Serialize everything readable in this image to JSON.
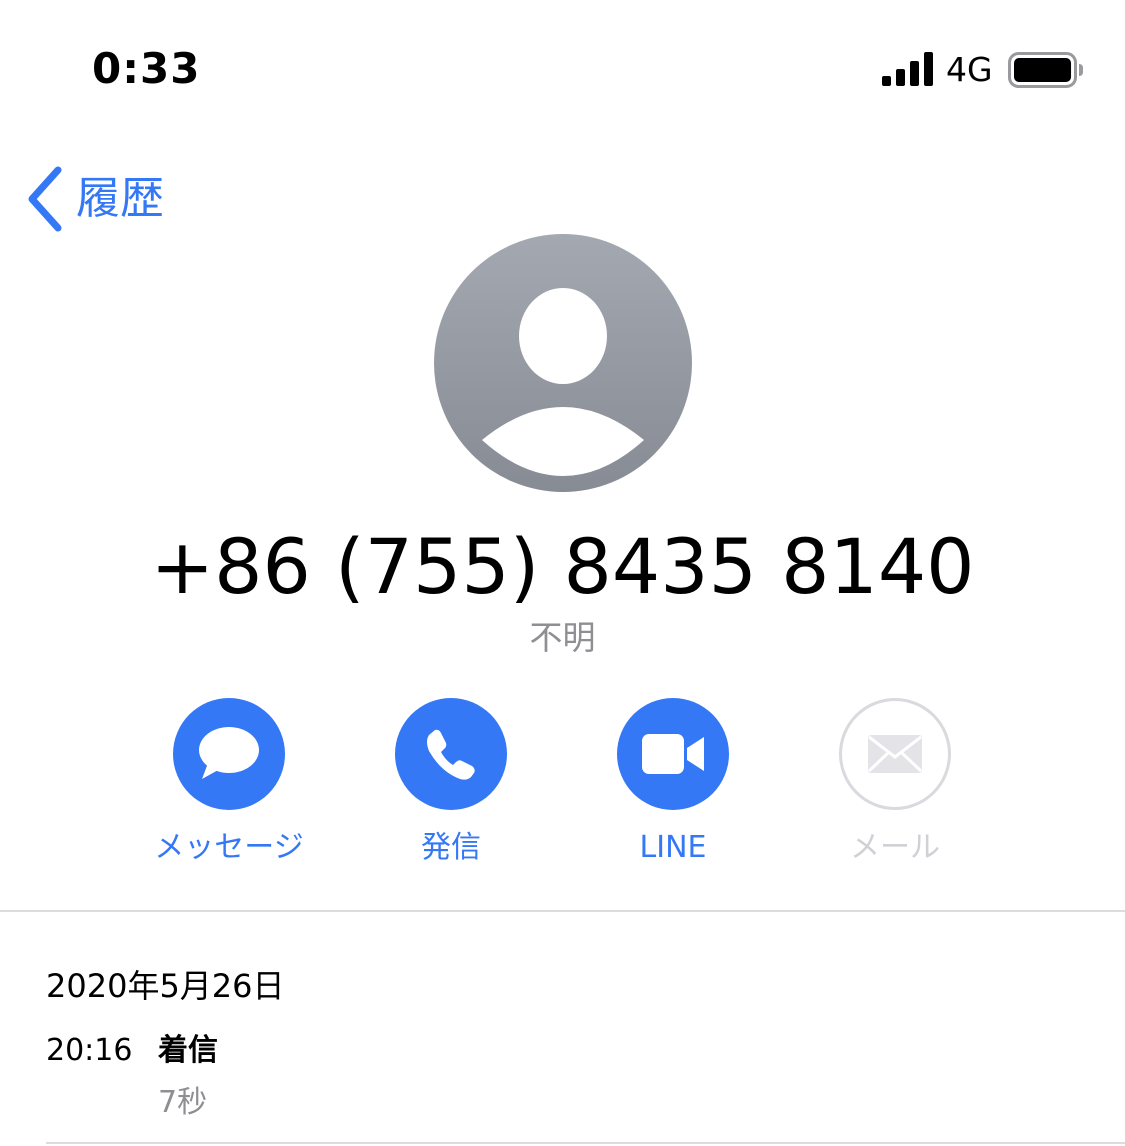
{
  "status_bar": {
    "time": "0:33",
    "network": "4G",
    "signal_icon": "cellular-signal-icon",
    "battery_icon": "battery-icon",
    "battery_level": 0.92
  },
  "nav": {
    "back_label": "履歴",
    "back_icon": "chevron-left-icon"
  },
  "contact": {
    "avatar_icon": "person-silhouette-icon",
    "phone_number": "+86 (755) 8435 8140",
    "subtitle": "不明"
  },
  "actions": [
    {
      "label": "メッセージ",
      "icon": "message-bubble-icon",
      "enabled": true
    },
    {
      "label": "発信",
      "icon": "phone-icon",
      "enabled": true
    },
    {
      "label": "LINE",
      "icon": "video-camera-icon",
      "enabled": true
    },
    {
      "label": "メール",
      "icon": "envelope-icon",
      "enabled": false
    }
  ],
  "call_log": {
    "date": "2020年5月26日",
    "entries": [
      {
        "time": "20:16",
        "type": "着信",
        "duration": "7秒"
      }
    ]
  },
  "colors": {
    "accent": "#3478f6",
    "secondary_text": "#8e8e93",
    "disabled": "#d9d9de"
  }
}
